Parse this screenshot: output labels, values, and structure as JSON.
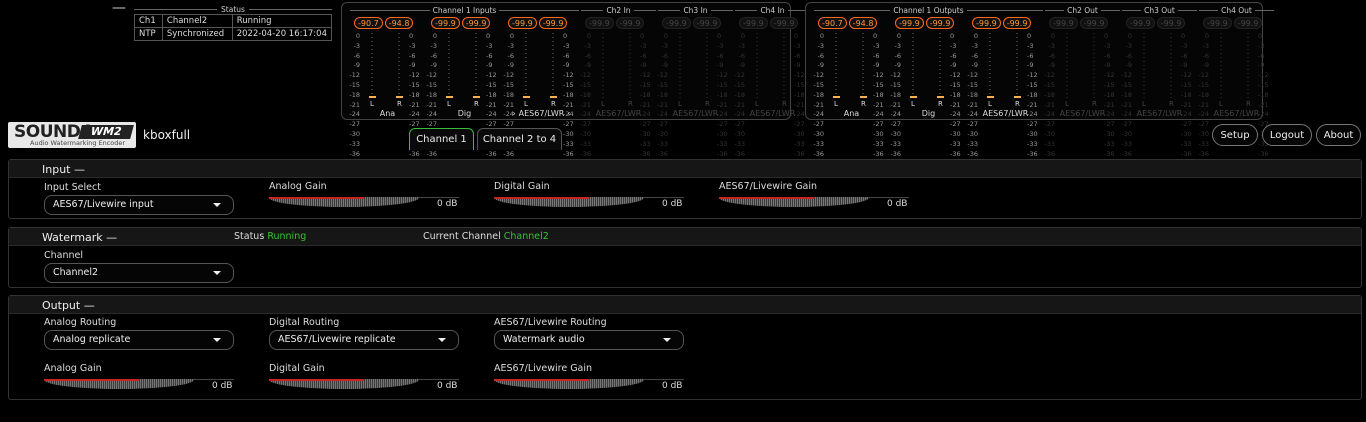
{
  "top_dash": "—",
  "status": {
    "title": "Status",
    "rows": [
      [
        "Ch1",
        "Channel2",
        "Running"
      ],
      [
        "NTP",
        "Synchronized",
        "2022-04-20 16:17:04"
      ]
    ]
  },
  "inputs": {
    "groups": [
      {
        "title": "Channel 1 Inputs",
        "active": true,
        "peaks": [
          [
            "-90.7",
            "-94.8"
          ],
          [
            "-99.9",
            "-99.9"
          ],
          [
            "-99.9",
            "-99.9"
          ]
        ],
        "channels": [
          {
            "label": "Ana"
          },
          {
            "label": "Dig"
          },
          {
            "label": "AES67/LWR",
            "prefix": "›",
            "suffix": "‹"
          }
        ]
      },
      {
        "title": "Ch2 In",
        "active": false,
        "peaks": [
          [
            "-99.9",
            "-99.9"
          ]
        ],
        "channels": [
          {
            "label": "AES67/LWR"
          }
        ]
      },
      {
        "title": "Ch3 In",
        "active": false,
        "peaks": [
          [
            "-99.9",
            "-99.9"
          ]
        ],
        "channels": [
          {
            "label": "AES67/LWR"
          }
        ]
      },
      {
        "title": "Ch4 In",
        "active": false,
        "peaks": [
          [
            "-99.9",
            "-99.9"
          ]
        ],
        "channels": [
          {
            "label": "AES67/LWR"
          }
        ]
      }
    ]
  },
  "outputs": {
    "groups": [
      {
        "title": "Channel 1 Outputs",
        "active": true,
        "peaks": [
          [
            "-90.7",
            "-94.8"
          ],
          [
            "-99.9",
            "-99.9"
          ],
          [
            "-99.9",
            "-99.9"
          ]
        ],
        "channels": [
          {
            "label": "Ana"
          },
          {
            "label": "Dig"
          },
          {
            "label": "AES67/LWR"
          }
        ]
      },
      {
        "title": "Ch2 Out",
        "active": false,
        "peaks": [
          [
            "-99.9",
            "-99.9"
          ]
        ],
        "channels": [
          {
            "label": "AES67/LWR"
          }
        ]
      },
      {
        "title": "Ch3 Out",
        "active": false,
        "peaks": [
          [
            "-99.9",
            "-99.9"
          ]
        ],
        "channels": [
          {
            "label": "AES67/LWR"
          }
        ]
      },
      {
        "title": "Ch4 Out",
        "active": false,
        "peaks": [
          [
            "-99.9",
            "-99.9"
          ]
        ],
        "channels": [
          {
            "label": "AES67/LWR"
          }
        ]
      }
    ]
  },
  "meter_scale": [
    "0",
    "-3",
    "-6",
    "-9",
    "-12",
    "-15",
    "-18",
    "-21",
    "-24",
    "-27",
    "-30",
    "-33",
    "-36"
  ],
  "meter_lr": [
    "L",
    "R"
  ],
  "logo": {
    "brand": "SOUND4",
    "product": "WM2",
    "tagline": "Audio Watermarking Encoder"
  },
  "device_name": "kboxfull",
  "tabs": [
    {
      "label": "Channel 1",
      "active": true
    },
    {
      "label": "Channel 2 to 4",
      "active": false
    }
  ],
  "nav": {
    "setup": "Setup",
    "logout": "Logout",
    "about": "About"
  },
  "input": {
    "title": "Input",
    "toggle": "—",
    "select_label": "Input Select",
    "select_value": "AES67/Livewire input",
    "gains": [
      {
        "label": "Analog Gain",
        "value": "0",
        "unit": "dB",
        "level": 0.63
      },
      {
        "label": "Digital Gain",
        "value": "0",
        "unit": "dB",
        "level": 0.63
      },
      {
        "label": "AES67/Livewire Gain",
        "value": "0",
        "unit": "dB",
        "level": 0.63
      }
    ]
  },
  "watermark": {
    "title": "Watermark",
    "toggle": "—",
    "status_label": "Status",
    "status_value": "Running",
    "current_label": "Current Channel",
    "current_value": "Channel2",
    "channel_label": "Channel",
    "channel_value": "Channel2"
  },
  "output": {
    "title": "Output",
    "toggle": "—",
    "routing": [
      {
        "label": "Analog Routing",
        "value": "Analog replicate"
      },
      {
        "label": "Digital Routing",
        "value": "AES67/Livewire replicate"
      },
      {
        "label": "AES67/Livewire Routing",
        "value": "Watermark audio"
      }
    ],
    "gains": [
      {
        "label": "Analog Gain",
        "value": "0",
        "unit": "dB",
        "level": 0.63
      },
      {
        "label": "Digital Gain",
        "value": "0",
        "unit": "dB",
        "level": 0.63
      },
      {
        "label": "AES67/Livewire Gain",
        "value": "0",
        "unit": "dB",
        "level": 0.63
      }
    ]
  },
  "colors": {
    "accent_green": "#35c335",
    "peak_orange": "#ff9a3a",
    "gain_red": "#cc2222"
  }
}
